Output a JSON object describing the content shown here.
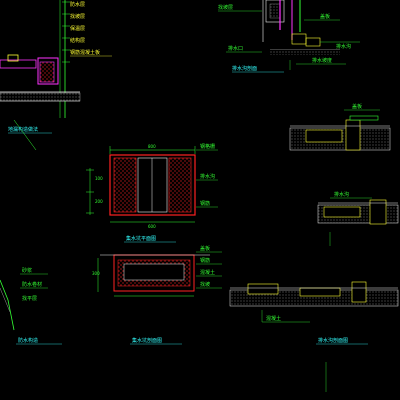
{
  "drawing": {
    "background": "#000000",
    "colors": {
      "magenta": "#ff33ff",
      "yellow": "#ffff33",
      "green": "#33ff33",
      "cyan": "#33ffff",
      "red": "#ff2222",
      "white": "#f0f0f0",
      "blue": "#3333ff",
      "orange": "#ff9933",
      "gray": "#9a9a9a"
    },
    "labels": {
      "top_left_1": "防水层",
      "top_left_2": "找坡层",
      "top_left_3": "保温层",
      "top_left_4": "结构层",
      "top_left_5": "钢筋混凝土板",
      "left_mid_title": "地漏构造做法",
      "left_a": "排水口",
      "left_b": "砂浆",
      "left_c": "防水卷材",
      "top_mid_1": "找坡层",
      "top_mid_2": "排水沟",
      "top_mid_3": "盖板",
      "top_mid_4": "排水坡度",
      "top_mid_title": "排水沟剖面",
      "center_box_1": "钢格栅",
      "center_box_2": "排水沟",
      "center_box_3": "钢筋",
      "center_title": "集水坑平面图",
      "center_dim_a": "800",
      "center_dim_b": "600",
      "left_dim_1": "100",
      "left_dim_2": "200",
      "left_dim_3": "300",
      "bottom_box_1": "盖板",
      "bottom_box_2": "钢筋",
      "bottom_box_3": "混凝土",
      "bottom_box_4": "找坡",
      "bottom_title": "集水坑剖面图",
      "right_title": "排水沟剖面图",
      "right_note_1": "盖板",
      "right_note_2": "排水沟",
      "right_note_3": "混凝土",
      "left_bottom_title": "防水构造",
      "left_bottom_2": "找平层"
    }
  }
}
